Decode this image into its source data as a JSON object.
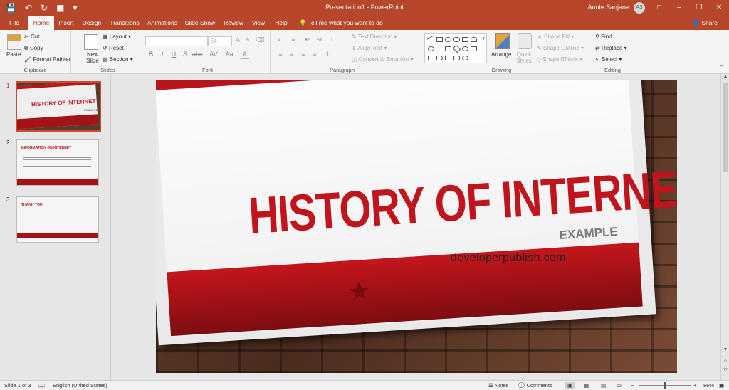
{
  "titlebar": {
    "title": "Presentation1  -  PowerPoint",
    "user": "Annie Sanjana",
    "initials": "AS"
  },
  "tabs": [
    "File",
    "Home",
    "Insert",
    "Design",
    "Transitions",
    "Animations",
    "Slide Show",
    "Review",
    "View",
    "Help"
  ],
  "active_tab": "Home",
  "tell_me": "Tell me what you want to do",
  "share": "Share",
  "ribbon": {
    "clipboard": {
      "paste": "Paste",
      "cut": "Cut",
      "copy": "Copy",
      "format_painter": "Format Painter",
      "label": "Clipboard"
    },
    "slides": {
      "new_slide": "New Slide",
      "layout": "Layout",
      "reset": "Reset",
      "section": "Section",
      "label": "Slides"
    },
    "font": {
      "size": "54",
      "label": "Font"
    },
    "paragraph": {
      "text_direction": "Text Direction",
      "align_text": "Align Text",
      "smartart": "Convert to SmartArt",
      "label": "Paragraph"
    },
    "drawing": {
      "arrange": "Arrange",
      "quick_styles": "Quick Styles",
      "shape_fill": "Shape Fill",
      "shape_outline": "Shape Outline",
      "shape_effects": "Shape Effects",
      "label": "Drawing"
    },
    "editing": {
      "find": "Find",
      "replace": "Replace",
      "select": "Select",
      "label": "Editing"
    }
  },
  "thumbnails": [
    {
      "num": "1",
      "title": "HISTORY OF INTERNET",
      "sub": "EXAMPLE"
    },
    {
      "num": "2",
      "title": "INFORMATION ON INTERNET"
    },
    {
      "num": "3",
      "title": "THANK YOU!"
    }
  ],
  "slide": {
    "title": "HISTORY OF INTERNET",
    "subtitle": "EXAMPLE",
    "url": "developerpublish.com"
  },
  "status": {
    "slide_count": "Slide 1 of 3",
    "language": "English (United States)",
    "notes": "Notes",
    "comments": "Comments",
    "zoom": "86%"
  },
  "colors": {
    "accent": "#b7472a",
    "slide_red": "#c0151d"
  }
}
